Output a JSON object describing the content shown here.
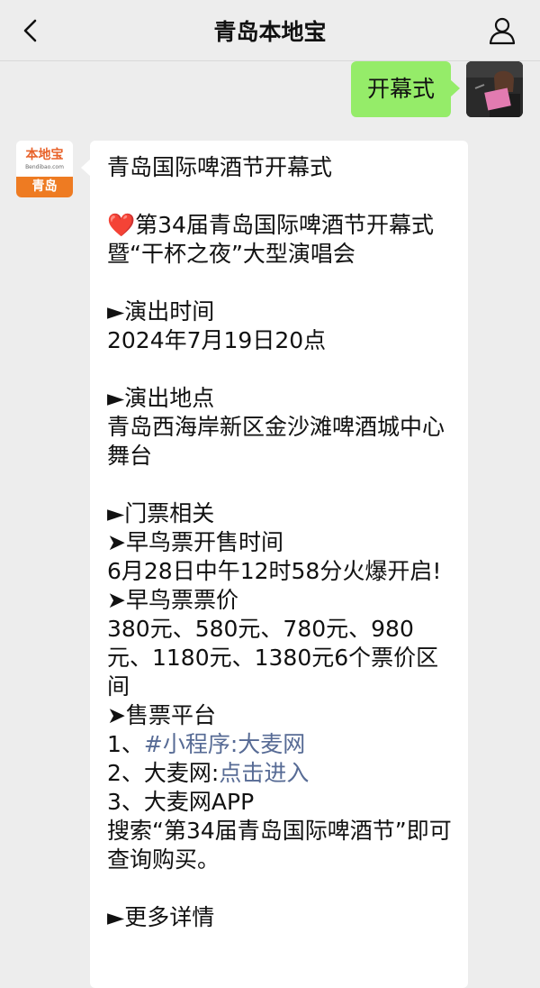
{
  "nav": {
    "title": "青岛本地宝"
  },
  "sent_message": {
    "text": "开幕式"
  },
  "bot_avatar": {
    "logo_text": "本地宝",
    "logo_sub": "Bendibao.com",
    "city": "青岛"
  },
  "reply": {
    "title": "青岛国际啤酒节开幕式",
    "heart": "❤️",
    "headline": "第34届青岛国际啤酒节开幕式暨“干杯之夜”大型演唱会",
    "time_label": "►演出时间",
    "time_value": "2024年7月19日20点",
    "place_label": "►演出地点",
    "place_value": "青岛西海岸新区金沙滩啤酒城中心舞台",
    "ticket_label": "►门票相关",
    "early_sale_label": "➤早鸟票开售时间",
    "early_sale_value": "6月28日中午12时58分火爆开启!",
    "early_price_label": "➤早鸟票票价",
    "early_price_value": "380元、580元、780元、980元、1180元、1380元6个票价区间",
    "platform_label": "➤售票平台",
    "platform_1_prefix": "1、",
    "platform_1_link": "#小程序:大麦网",
    "platform_2_prefix": "2、大麦网:",
    "platform_2_link": "点击进入",
    "platform_3": "3、大麦网APP",
    "search_hint": "搜索“第34届青岛国际啤酒节”即可查询购买。",
    "more_label": "►更多详情"
  },
  "colors": {
    "background": "#ededed",
    "sent_bubble": "#95ec69",
    "link": "#576b95",
    "brand_orange": "#ee7b22"
  },
  "icons": {
    "back": "chevron-left-icon",
    "profile": "person-icon"
  }
}
